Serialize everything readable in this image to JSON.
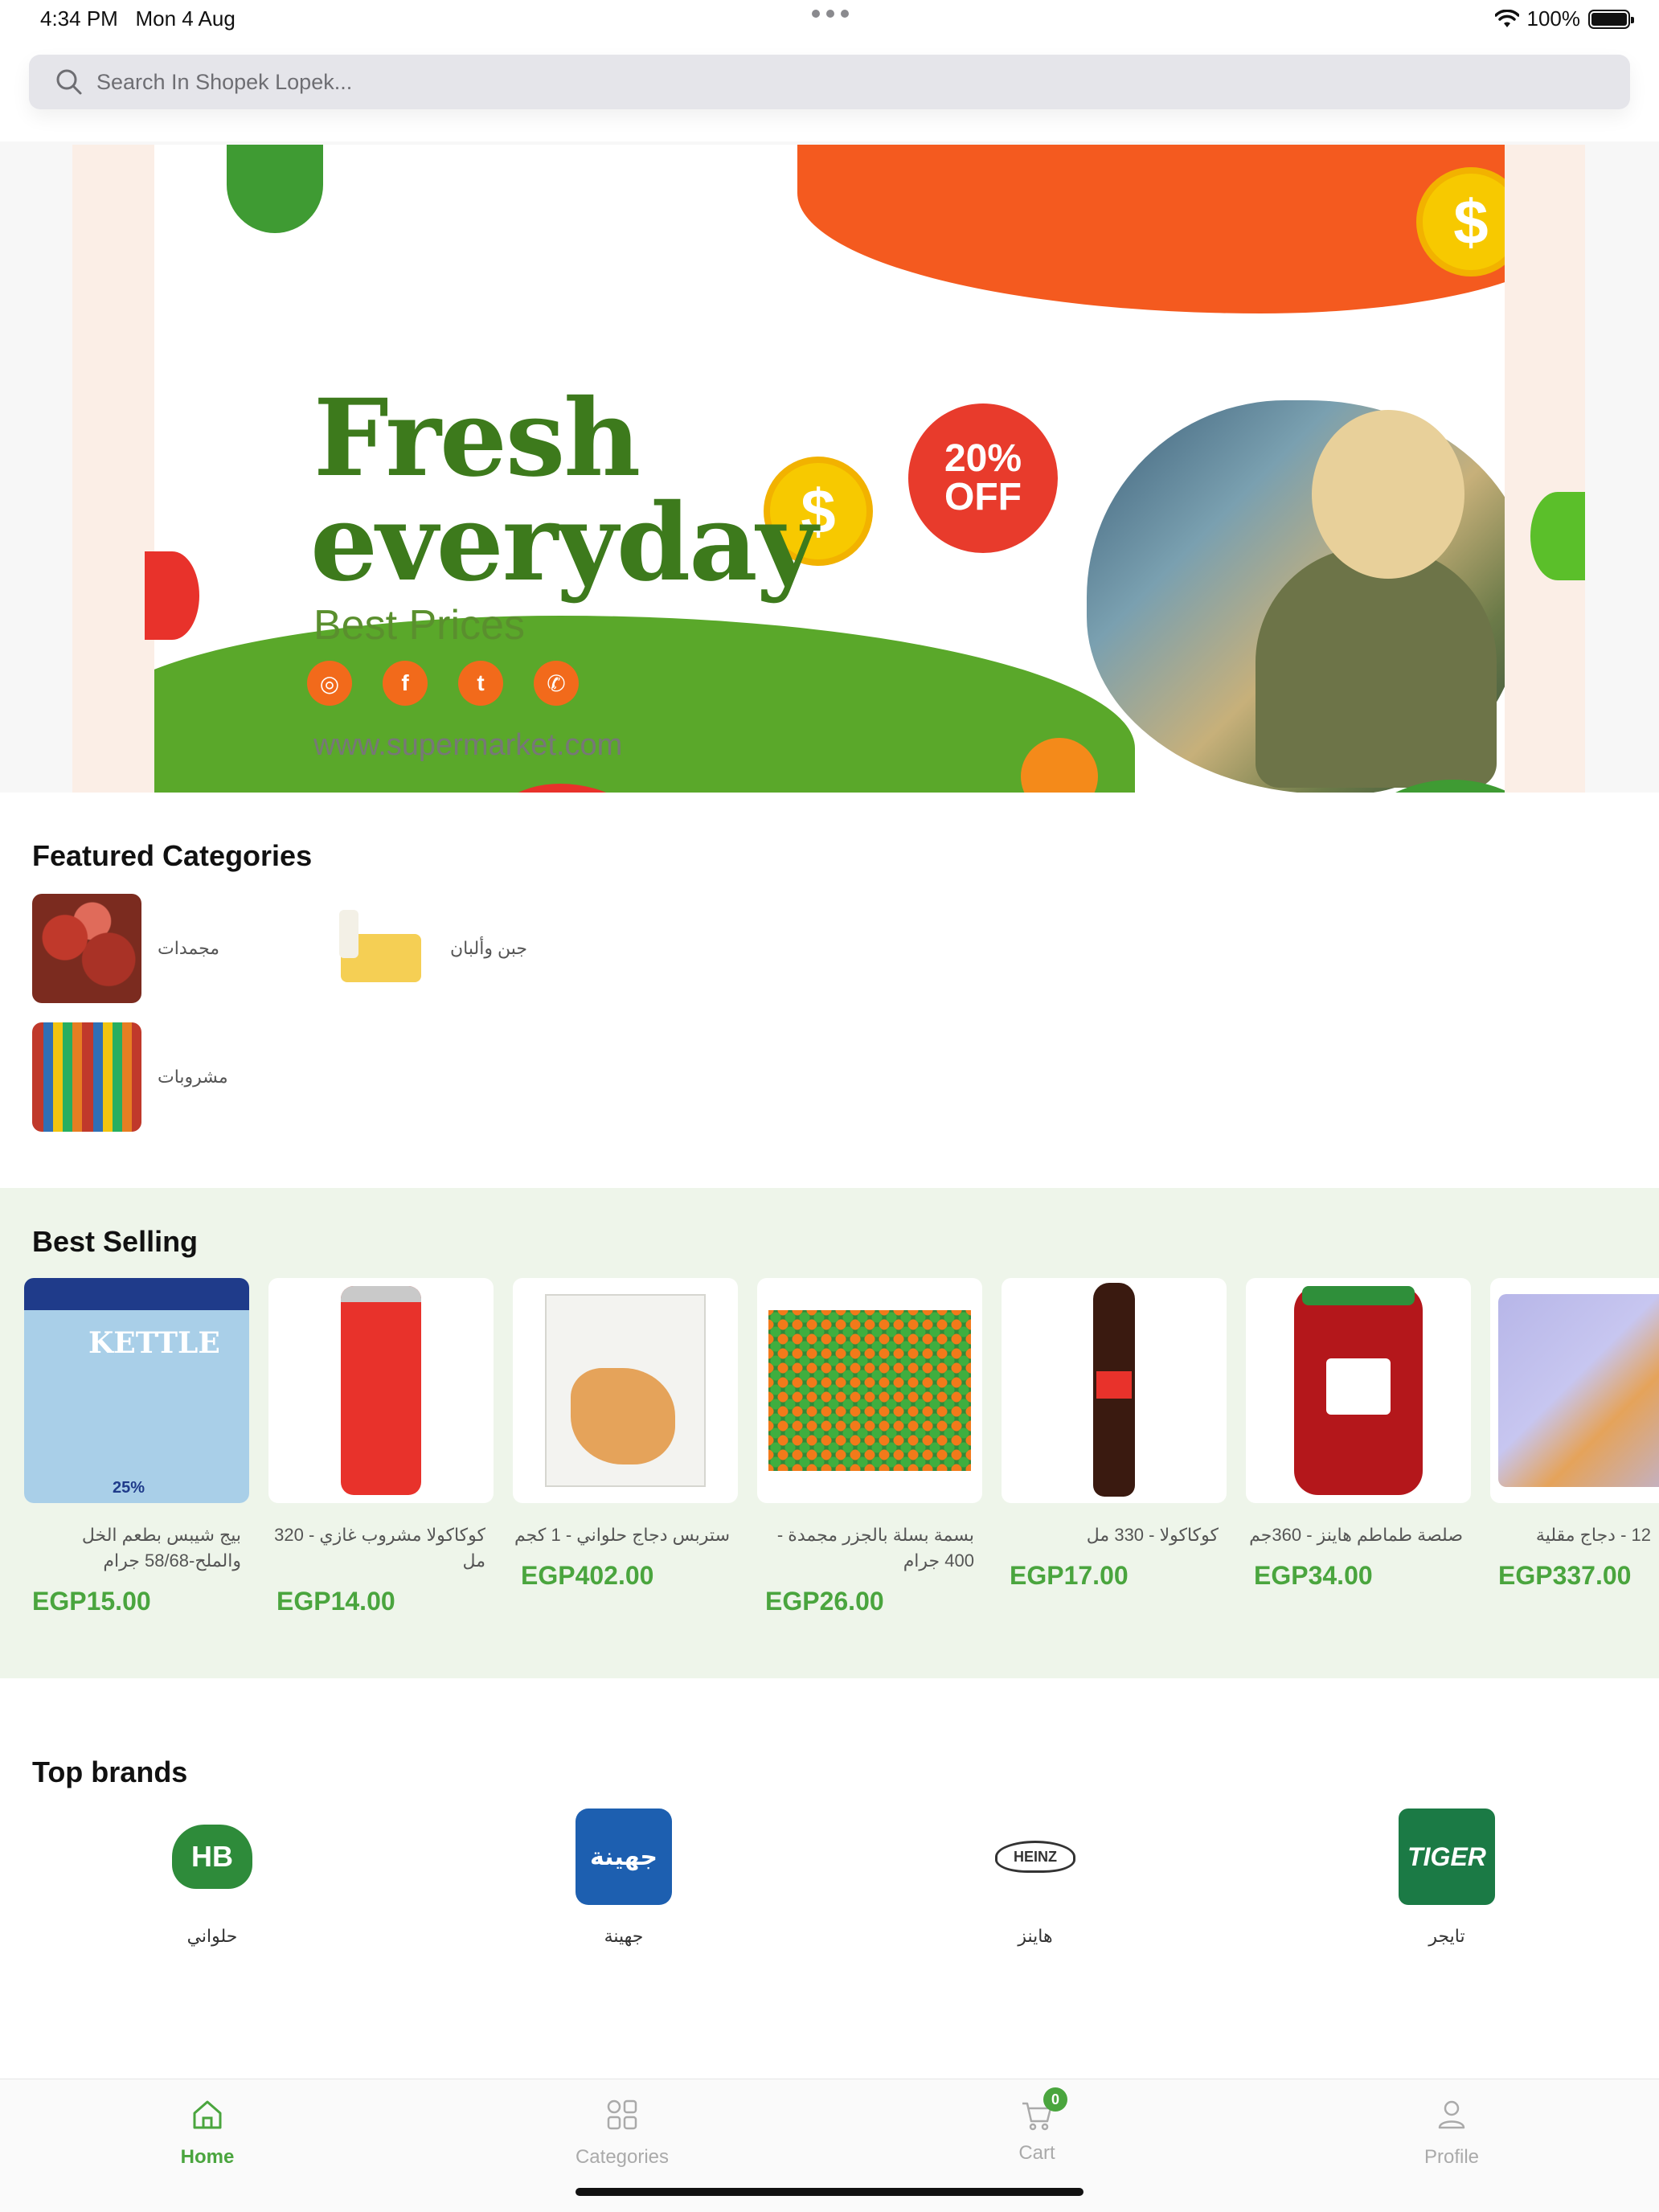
{
  "status_bar": {
    "time": "4:34 PM",
    "date": "Mon 4 Aug",
    "battery": "100%"
  },
  "search": {
    "placeholder": "Search In Shopek Lopek..."
  },
  "banner": {
    "title_line1": "Fresh",
    "title_line2": "everyday",
    "subtitle": "Best Prices",
    "discount_line1": "20%",
    "discount_line2": "OFF",
    "currency_symbol": "$",
    "url": "www.supermarket.com",
    "colors": {
      "green": "#3d7a1c",
      "orange": "#f45a1f",
      "red": "#e83b2c",
      "yellow": "#f7c900"
    }
  },
  "featured_categories": {
    "title": "Featured Categories",
    "items": [
      {
        "label": "مجمدات",
        "icon": "meat-image"
      },
      {
        "label": "جبن وألبان",
        "icon": "cheese-dairy-image"
      },
      {
        "label": "مشروبات",
        "icon": "drinks-image"
      }
    ]
  },
  "best_selling": {
    "title": "Best Selling",
    "products": [
      {
        "name": "بيج شيبس بطعم الخل والملح-58/68 جرام",
        "price": "EGP15.00",
        "image_text": "KETTLE",
        "image_badge": "25%"
      },
      {
        "name": "كوكاكولا مشروب غازي - 320 مل",
        "price": "EGP14.00"
      },
      {
        "name": "ستربس دجاج حلواني - 1 كجم",
        "price": "EGP402.00"
      },
      {
        "name": "بسمة بسلة بالجزر مجمدة - 400 جرام",
        "price": "EGP26.00"
      },
      {
        "name": "كوكاكولا - 330 مل",
        "price": "EGP17.00"
      },
      {
        "name": "صلصة طماطم هاينز - 360جم",
        "price": "EGP34.00"
      },
      {
        "name": "12 - دجاج مقلية",
        "price": "EGP337.00"
      }
    ]
  },
  "top_brands": {
    "title": "Top brands",
    "items": [
      {
        "name": "حلواني",
        "logo_text": "HB"
      },
      {
        "name": "جهينة",
        "logo_text": "جهينة"
      },
      {
        "name": "هاينز",
        "logo_text": "HEINZ"
      },
      {
        "name": "تايجر",
        "logo_text": "TIGER"
      }
    ]
  },
  "tabbar": {
    "home": "Home",
    "categories": "Categories",
    "cart": "Cart",
    "cart_count": "0",
    "profile": "Profile",
    "active_color": "#4aa53e"
  }
}
